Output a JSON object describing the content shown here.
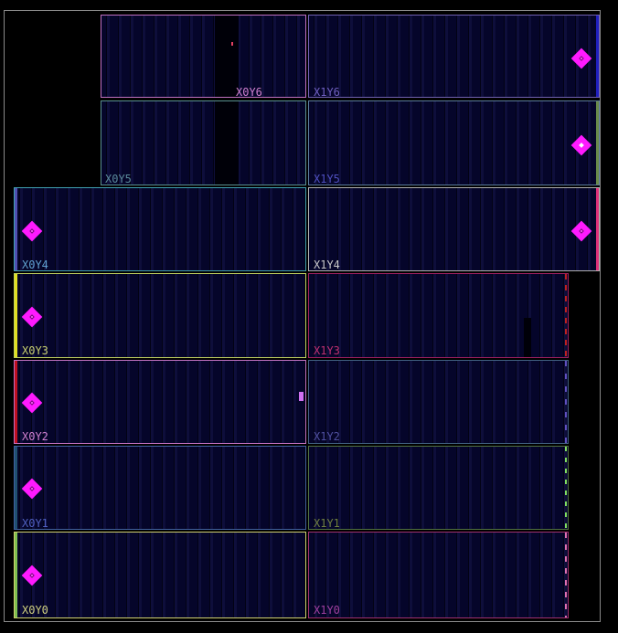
{
  "title": "",
  "palette": {
    "background": "#000000",
    "region_fill": "#05052a",
    "clock_marker": "#ff1aff"
  },
  "regions": [
    {
      "id": "X0Y6",
      "label": "X0Y6",
      "border": "#c070c0",
      "label_color": "#d080d0"
    },
    {
      "id": "X1Y6",
      "label": "X1Y6",
      "border": "#7060b0",
      "label_color": "#7060c0",
      "edge": "#2020c0"
    },
    {
      "id": "X0Y5",
      "label": "X0Y5",
      "border": "#5a9090",
      "label_color": "#5a8a9a"
    },
    {
      "id": "X1Y5",
      "label": "X1Y5",
      "border": "#5a7a9a",
      "label_color": "#5050c0",
      "edge": "#6a8a4a"
    },
    {
      "id": "X0Y4",
      "label": "X0Y4",
      "border": "#40a0b0",
      "label_color": "#60a0d0",
      "edge": "#5050b0"
    },
    {
      "id": "X1Y4",
      "label": "X1Y4",
      "border": "#b0b0b0",
      "label_color": "#c8c8c8",
      "edge": "#e0307a"
    },
    {
      "id": "X0Y3",
      "label": "X0Y3",
      "border": "#c0d060",
      "label_color": "#c8d070",
      "edge": "#e0e020"
    },
    {
      "id": "X1Y3",
      "label": "X1Y3",
      "border": "#a02060",
      "label_color": "#c03070",
      "edge": "#c02020"
    },
    {
      "id": "X0Y2",
      "label": "X0Y2",
      "border": "#c070c0",
      "label_color": "#d080d0",
      "edge": "#c01020"
    },
    {
      "id": "X1Y2",
      "label": "X1Y2",
      "border": "#406080",
      "label_color": "#5050a0",
      "edge": "#6050c0"
    },
    {
      "id": "X0Y1",
      "label": "X0Y1",
      "border": "#4060a0",
      "label_color": "#5060c0",
      "edge": "#205070"
    },
    {
      "id": "X1Y1",
      "label": "X1Y1",
      "border": "#507040",
      "label_color": "#708040",
      "edge": "#80e060"
    },
    {
      "id": "X0Y0",
      "label": "X0Y0",
      "border": "#d0d070",
      "label_color": "#d0d080",
      "edge": "#80c050"
    },
    {
      "id": "X1Y0",
      "label": "X1Y0",
      "border": "#a03070",
      "label_color": "#a040a0",
      "edge": "#e070b0"
    }
  ]
}
